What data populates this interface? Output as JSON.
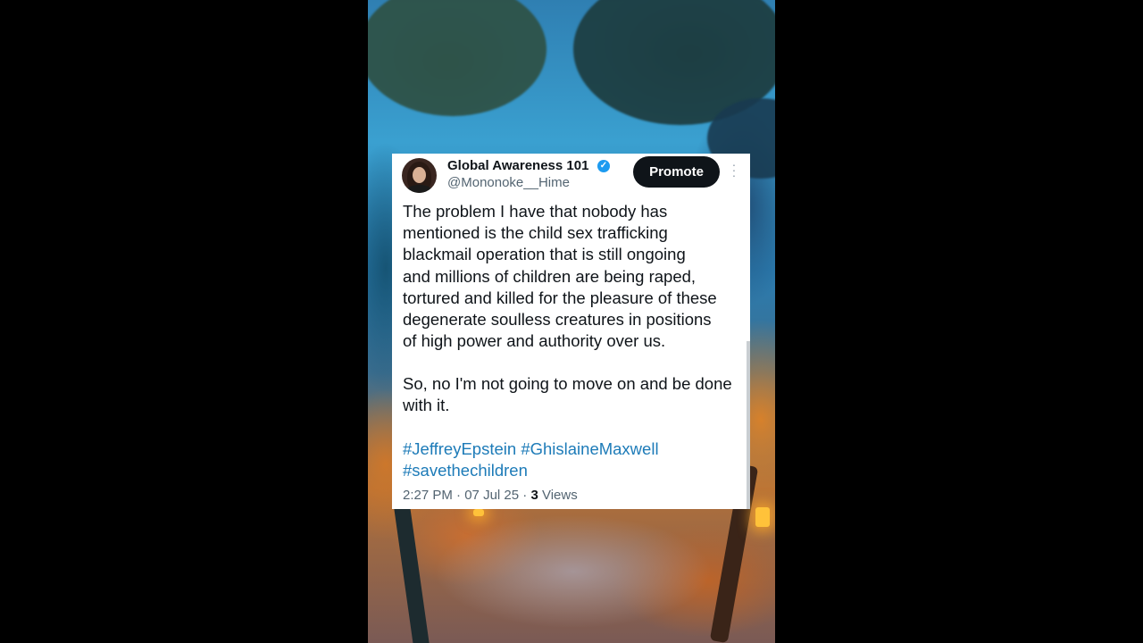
{
  "tweet": {
    "display_name": "Global Awareness 101",
    "verified_icon": "verified-badge-icon",
    "handle": "@Mononoke__Hime",
    "promote_label": "Promote",
    "more_icon": "more-options-icon",
    "body_lines": "The problem I have that nobody has\nmentioned is the child sex trafficking\nblackmail operation that is still ongoing\nand millions of children are being raped,\ntortured and killed for the pleasure of these\ndegenerate soulless creatures in positions\nof high power and authority over us.",
    "body_second": "So, no I'm not going to move on and be done\nwith it.",
    "hashtags": "#JeffreyEpstein #GhislaineMaxwell\n#savethechildren",
    "time": "2:27 PM",
    "date": "07 Jul 25",
    "views_count": "3",
    "views_label": "Views"
  },
  "colors": {
    "accent": "#1d9bf0",
    "hashtag": "#1d7bb8",
    "button_bg": "#0f1419",
    "text": "#0f1419",
    "muted": "#536471"
  }
}
